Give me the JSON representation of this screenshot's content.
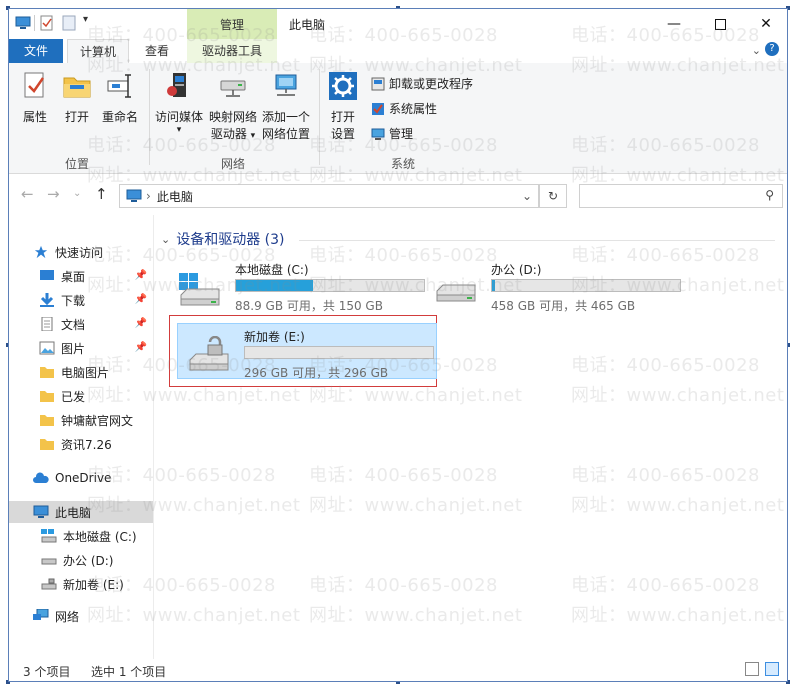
{
  "window": {
    "title": "此电脑",
    "context_tab_group": "管理",
    "controls": [
      "minimize-icon",
      "maximize-icon",
      "close-icon"
    ]
  },
  "ribbon_tabs": [
    {
      "label": "文件"
    },
    {
      "label": "计算机"
    },
    {
      "label": "查看"
    },
    {
      "label": "驱动器工具"
    }
  ],
  "ribbon": {
    "location_group": {
      "label": "位置",
      "buttons": [
        {
          "label": "属性",
          "icon": "properties-check-icon"
        },
        {
          "label": "打开",
          "icon": "folder-open-icon"
        },
        {
          "label": "重命名",
          "icon": "rename-icon"
        }
      ]
    },
    "network_group": {
      "label": "网络",
      "buttons": [
        {
          "label_line1": "访问媒体",
          "label_line2": "",
          "icon": "media-server-icon"
        },
        {
          "label_line1": "映射网络",
          "label_line2": "驱动器",
          "icon": "map-network-drive-icon"
        },
        {
          "label_line1": "添加一个",
          "label_line2": "网络位置",
          "icon": "add-network-location-icon"
        }
      ]
    },
    "system_group": {
      "label": "系统",
      "big_button": {
        "label_line1": "打开",
        "label_line2": "设置",
        "icon": "gear-icon"
      },
      "small_buttons": [
        {
          "label": "卸载或更改程序",
          "icon": "uninstall-icon"
        },
        {
          "label": "系统属性",
          "icon": "system-properties-icon"
        },
        {
          "label": "管理",
          "icon": "computer-management-icon"
        }
      ]
    }
  },
  "address_bar": {
    "path": "此电脑",
    "search_placeholder": ""
  },
  "nav_pane": {
    "quick_access": "快速访问",
    "quick_items": [
      {
        "label": "桌面",
        "pinned": true
      },
      {
        "label": "下载",
        "pinned": true
      },
      {
        "label": "文档",
        "pinned": true
      },
      {
        "label": "图片",
        "pinned": true
      },
      {
        "label": "电脑图片",
        "pinned": false
      },
      {
        "label": "已发",
        "pinned": false
      },
      {
        "label": "钟墉献官网文",
        "pinned": false
      },
      {
        "label": "资讯7.26",
        "pinned": false
      }
    ],
    "onedrive": "OneDrive",
    "this_pc": "此电脑",
    "drives": [
      {
        "label": "本地磁盘 (C:)"
      },
      {
        "label": "办公 (D:)"
      },
      {
        "label": "新加卷 (E:)"
      }
    ],
    "network": "网络"
  },
  "content": {
    "section_title": "设备和驱动器 (3)",
    "drives": [
      {
        "name": "本地磁盘 (C:)",
        "info": "88.9 GB 可用，共 150 GB",
        "used_fraction": 0.41,
        "selected": false
      },
      {
        "name": "办公 (D:)",
        "info": "458 GB 可用，共 465 GB",
        "used_fraction": 0.015,
        "selected": false
      },
      {
        "name": "新加卷 (E:)",
        "info": "296 GB 可用，共 296 GB",
        "used_fraction": 0.0,
        "selected": true
      }
    ]
  },
  "status_bar": {
    "item_count": "3 个项目",
    "selection": "选中 1 个项目"
  },
  "watermark": {
    "phone": "电话：400-665-0028",
    "site": "网址：www.chanjet.net"
  },
  "colors": {
    "accent": "#1f6fbe",
    "selection": "#cce8ff",
    "usage_bar": "#26a0da",
    "highlight_box": "#d23c3c",
    "context_tab": "#d9ecb6"
  }
}
